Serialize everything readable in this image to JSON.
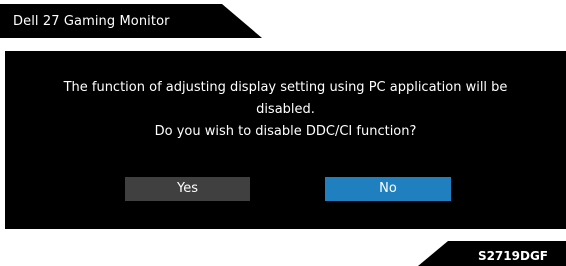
{
  "header": {
    "title": "Dell 27 Gaming Monitor"
  },
  "dialog": {
    "message_line1": "The function of adjusting display setting using PC application will be",
    "message_line2": "disabled.",
    "message_line3": "Do you wish to disable DDC/CI function?",
    "yes_label": "Yes",
    "no_label": "No",
    "selected_option": "No"
  },
  "footer": {
    "model": "S2719DGF"
  },
  "colors": {
    "background": "#ffffff",
    "panel": "#000000",
    "button_default": "#404040",
    "button_selected": "#1f7fbf",
    "text": "#ffffff"
  }
}
